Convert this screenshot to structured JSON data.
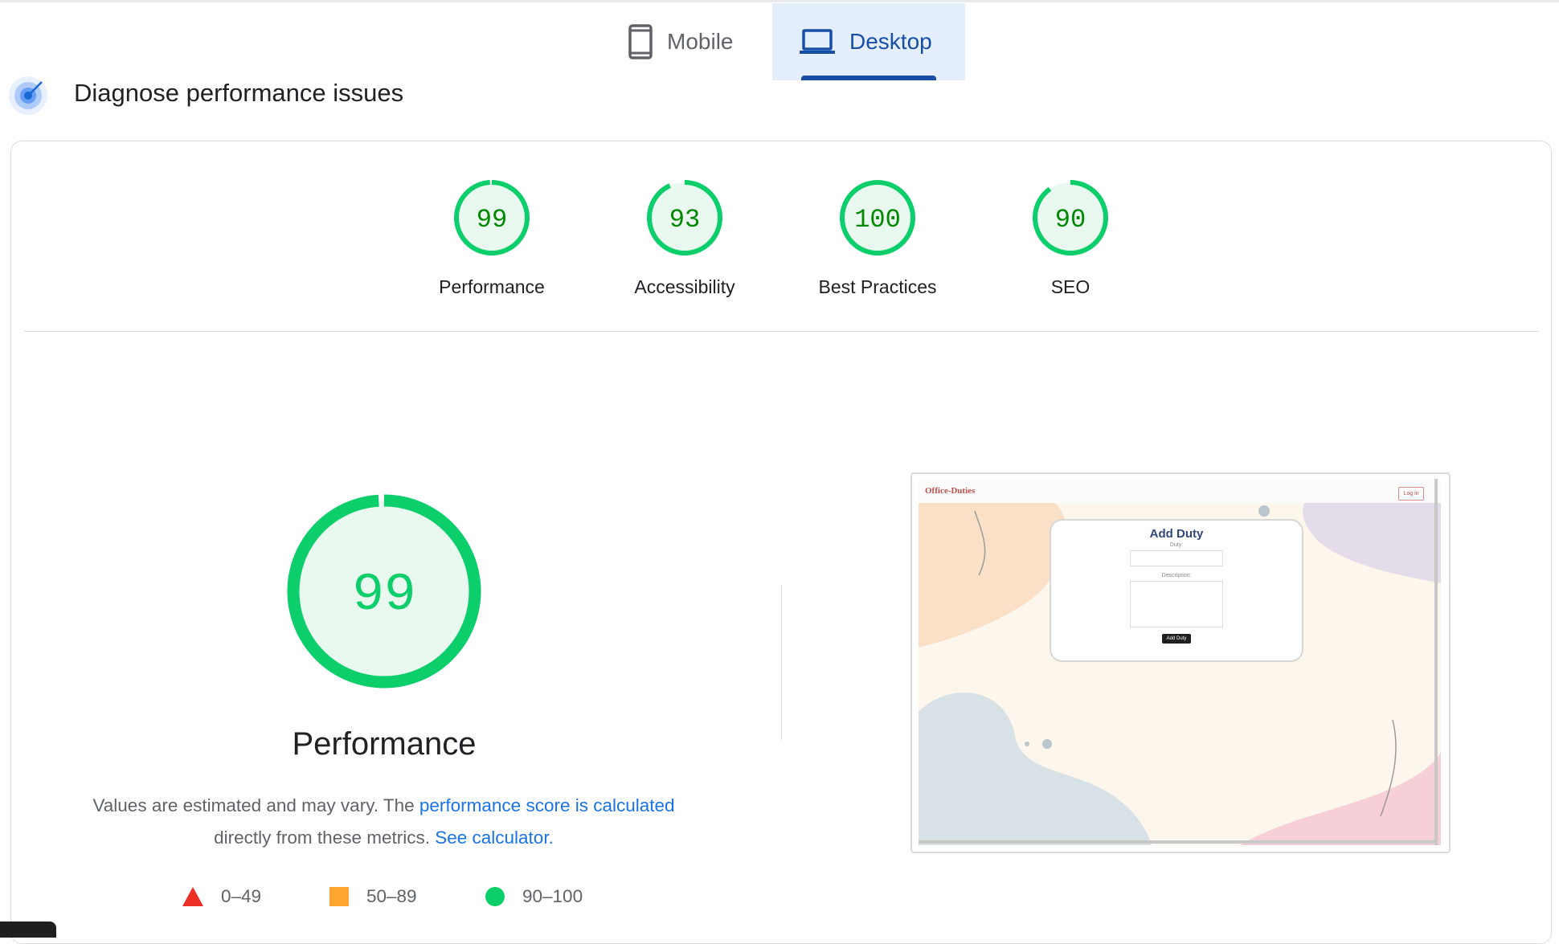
{
  "tabs": {
    "mobile": {
      "label": "Mobile",
      "icon": "phone-icon"
    },
    "desktop": {
      "label": "Desktop",
      "icon": "laptop-icon",
      "selected": true
    }
  },
  "heading": {
    "title": "Diagnose performance issues",
    "icon": "diagnose-target-icon"
  },
  "categories": [
    {
      "label": "Performance",
      "score": "99",
      "fraction": 0.99
    },
    {
      "label": "Accessibility",
      "score": "93",
      "fraction": 0.93
    },
    {
      "label": "Best Practices",
      "score": "100",
      "fraction": 1.0
    },
    {
      "label": "SEO",
      "score": "90",
      "fraction": 0.9
    }
  ],
  "performance": {
    "score": "99",
    "fraction": 0.99,
    "title": "Performance",
    "note_part1": "Values are estimated and may vary. The ",
    "note_link1": "performance score is calculated",
    "note_part2": " directly from these metrics. ",
    "note_link2": "See calculator."
  },
  "legend": [
    {
      "range": "0–49",
      "shape": "triangle",
      "color": "#eb2f25"
    },
    {
      "range": "50–89",
      "shape": "square",
      "color": "#ffa531"
    },
    {
      "range": "90–100",
      "shape": "circle",
      "color": "#0cce6b"
    }
  ],
  "screenshot": {
    "brand": "Office-Duties",
    "login": "Log in",
    "form_title": "Add Duty",
    "duty_label": "Duty:",
    "description_label": "Description:",
    "button": "Add Duty"
  },
  "colors": {
    "pass": "#0cce6b",
    "pass_text": "#008800",
    "pass_bg": "#e9f9ef",
    "link": "#1a73e8",
    "tab_selected_bg": "#e4eefc"
  }
}
